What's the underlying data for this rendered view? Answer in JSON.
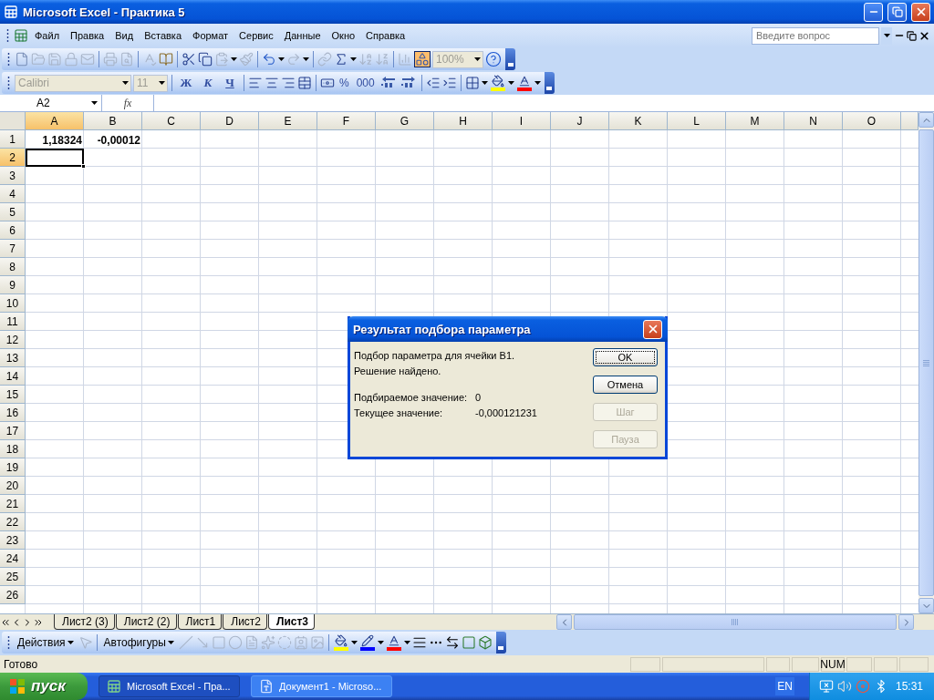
{
  "window": {
    "title": "Microsoft Excel - Практика 5"
  },
  "menu": [
    "Файл",
    "Правка",
    "Вид",
    "Вставка",
    "Формат",
    "Сервис",
    "Данные",
    "Окно",
    "Справка"
  ],
  "help_box": {
    "placeholder": "Введите вопрос"
  },
  "standard_toolbar": {
    "zoom": "100%"
  },
  "formatting_toolbar": {
    "font": "Calibri",
    "size": "11",
    "style_buttons": [
      "Ж",
      "К",
      "Ч"
    ],
    "number_buttons": [
      "%",
      "000"
    ]
  },
  "formula_bar": {
    "name_box": "A2",
    "function_label": "fx"
  },
  "columns": [
    {
      "label": "A",
      "selected": true
    },
    {
      "label": "B",
      "selected": false
    },
    {
      "label": "C",
      "selected": false
    },
    {
      "label": "D",
      "selected": false
    },
    {
      "label": "E",
      "selected": false
    },
    {
      "label": "F",
      "selected": false
    },
    {
      "label": "G",
      "selected": false
    },
    {
      "label": "H",
      "selected": false
    },
    {
      "label": "I",
      "selected": false
    },
    {
      "label": "J",
      "selected": false
    },
    {
      "label": "K",
      "selected": false
    },
    {
      "label": "L",
      "selected": false
    },
    {
      "label": "M",
      "selected": false
    },
    {
      "label": "N",
      "selected": false
    },
    {
      "label": "O",
      "selected": false
    }
  ],
  "rows": [
    {
      "label": "1",
      "selected": false,
      "cells": [
        "1,18324",
        "-0,00012"
      ]
    },
    {
      "label": "2",
      "selected": true
    },
    {
      "label": "3",
      "selected": false
    },
    {
      "label": "4",
      "selected": false
    },
    {
      "label": "5",
      "selected": false
    },
    {
      "label": "6",
      "selected": false
    },
    {
      "label": "7",
      "selected": false
    },
    {
      "label": "8",
      "selected": false
    },
    {
      "label": "9",
      "selected": false
    },
    {
      "label": "10",
      "selected": false
    },
    {
      "label": "11",
      "selected": false
    },
    {
      "label": "12",
      "selected": false
    },
    {
      "label": "13",
      "selected": false
    },
    {
      "label": "14",
      "selected": false
    },
    {
      "label": "15",
      "selected": false
    },
    {
      "label": "16",
      "selected": false
    },
    {
      "label": "17",
      "selected": false
    },
    {
      "label": "18",
      "selected": false
    },
    {
      "label": "19",
      "selected": false
    },
    {
      "label": "20",
      "selected": false
    },
    {
      "label": "21",
      "selected": false
    },
    {
      "label": "22",
      "selected": false
    },
    {
      "label": "23",
      "selected": false
    },
    {
      "label": "24",
      "selected": false
    },
    {
      "label": "25",
      "selected": false
    },
    {
      "label": "26",
      "selected": false
    }
  ],
  "sheet_tabs": [
    {
      "label": "Лист2 (3)",
      "selected": false
    },
    {
      "label": "Лист2 (2)",
      "selected": false
    },
    {
      "label": "Лист1",
      "selected": false
    },
    {
      "label": "Лист2",
      "selected": false
    },
    {
      "label": "Лист3",
      "selected": true
    }
  ],
  "drawing_toolbar": {
    "actions": "Действия",
    "autoshapes": "Автофигуры"
  },
  "dialog": {
    "title": "Результат подбора параметра",
    "lines": [
      "Подбор параметра для ячейки B1.",
      "Решение найдено."
    ],
    "fields": [
      {
        "label": "Подбираемое значение:",
        "value": "0"
      },
      {
        "label": "Текущее значение:",
        "value": "-0,000121231"
      }
    ],
    "buttons": [
      {
        "label": "OK",
        "disabled": false,
        "focused": true
      },
      {
        "label": "Отмена",
        "disabled": false,
        "focused": false
      },
      {
        "label": "Шаг",
        "disabled": true,
        "focused": false
      },
      {
        "label": "Пауза",
        "disabled": true,
        "focused": false
      }
    ]
  },
  "status_bar": {
    "text": "Готово",
    "num": "NUM"
  },
  "taskbar": {
    "start": "пуск",
    "tasks": [
      {
        "label": "Microsoft Excel - Пра...",
        "selected": true
      },
      {
        "label": "Документ1 - Microso...",
        "selected": false
      }
    ],
    "language": "EN",
    "clock": "15:31"
  }
}
